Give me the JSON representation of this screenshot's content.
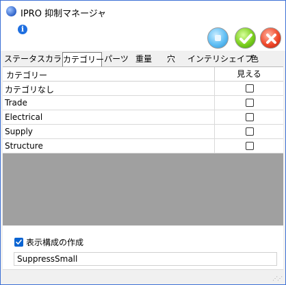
{
  "window": {
    "title": "IPRO 抑制マネージャ",
    "app_icon": "globe-icon"
  },
  "toolbar": {
    "info_icon": "info-icon",
    "info_glyph": "i",
    "buttons": [
      {
        "icon": "stop-icon",
        "color": "#4fb3ef"
      },
      {
        "icon": "checkmark-icon",
        "color": "#6cc21a"
      },
      {
        "icon": "close-icon",
        "color": "#e8402a"
      }
    ]
  },
  "tabs": [
    {
      "label": "ステータスカラー",
      "active": false
    },
    {
      "label": "カテゴリー",
      "active": true
    },
    {
      "label": "パーツ",
      "active": false
    },
    {
      "label": "重量",
      "active": false
    },
    {
      "label": "穴",
      "active": false
    },
    {
      "label": "インテリシェイプ",
      "active": false
    },
    {
      "label": "色",
      "active": false
    }
  ],
  "grid": {
    "columns": [
      "カテゴリー",
      "見える"
    ],
    "rows": [
      {
        "name": "カテゴリなし",
        "visible": false
      },
      {
        "name": "Trade",
        "visible": false
      },
      {
        "name": "Electrical",
        "visible": false
      },
      {
        "name": "Supply",
        "visible": false
      },
      {
        "name": "Structure",
        "visible": false
      }
    ]
  },
  "options": {
    "create_display_config_label": "表示構成の作成",
    "create_display_config_checked": true,
    "config_name_value": "SuppressSmall"
  },
  "colors": {
    "accent": "#0a64d2",
    "window_border": "#3b6fd6",
    "empty_area": "#a0a0a0"
  }
}
